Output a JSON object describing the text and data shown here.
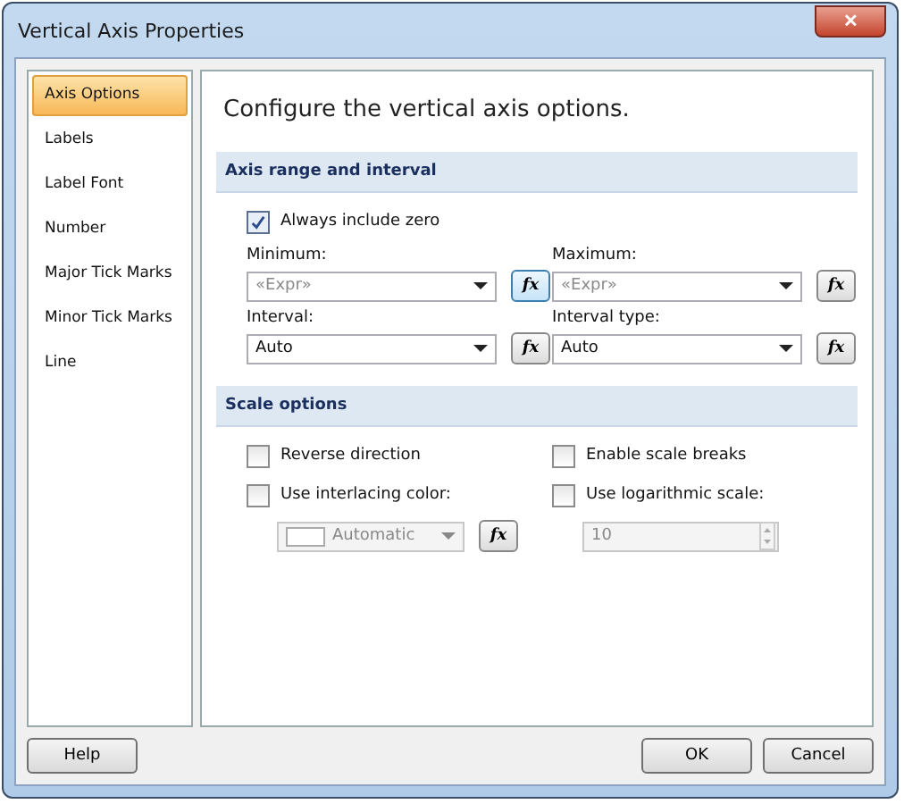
{
  "window": {
    "title": "Vertical Axis Properties",
    "close": "✕"
  },
  "sidebar": {
    "items": [
      {
        "label": "Axis Options",
        "selected": true
      },
      {
        "label": "Labels",
        "selected": false
      },
      {
        "label": "Label Font",
        "selected": false
      },
      {
        "label": "Number",
        "selected": false
      },
      {
        "label": "Major Tick Marks",
        "selected": false
      },
      {
        "label": "Minor Tick Marks",
        "selected": false
      },
      {
        "label": "Line",
        "selected": false
      }
    ]
  },
  "heading": "Configure the vertical axis options.",
  "range_section": {
    "title": "Axis range and interval",
    "always_zero": {
      "label": "Always include zero",
      "checked": true
    },
    "fields": [
      {
        "label": "Minimum:",
        "placeholder": "«Expr»",
        "fx": "fx",
        "focused": true
      },
      {
        "label": "Maximum:",
        "placeholder": "«Expr»",
        "fx": "fx",
        "focused": false
      },
      {
        "label": "Interval:",
        "value": "Auto",
        "fx": "fx",
        "focused": false
      },
      {
        "label": "Interval type:",
        "value": "Auto",
        "fx": "fx",
        "focused": false
      }
    ]
  },
  "scale_section": {
    "title": "Scale options",
    "options": [
      {
        "label": "Reverse direction",
        "checked": false
      },
      {
        "label": "Enable scale breaks",
        "checked": false
      },
      {
        "label": "Use interlacing color:",
        "checked": false
      },
      {
        "label": "Use logarithmic scale:",
        "checked": false
      }
    ],
    "interlace_color": {
      "value": "Automatic",
      "fx": "fx",
      "disabled": true
    },
    "log_base": {
      "value": "10",
      "disabled": true
    }
  },
  "buttons": {
    "help": "Help",
    "ok": "OK",
    "cancel": "Cancel"
  }
}
